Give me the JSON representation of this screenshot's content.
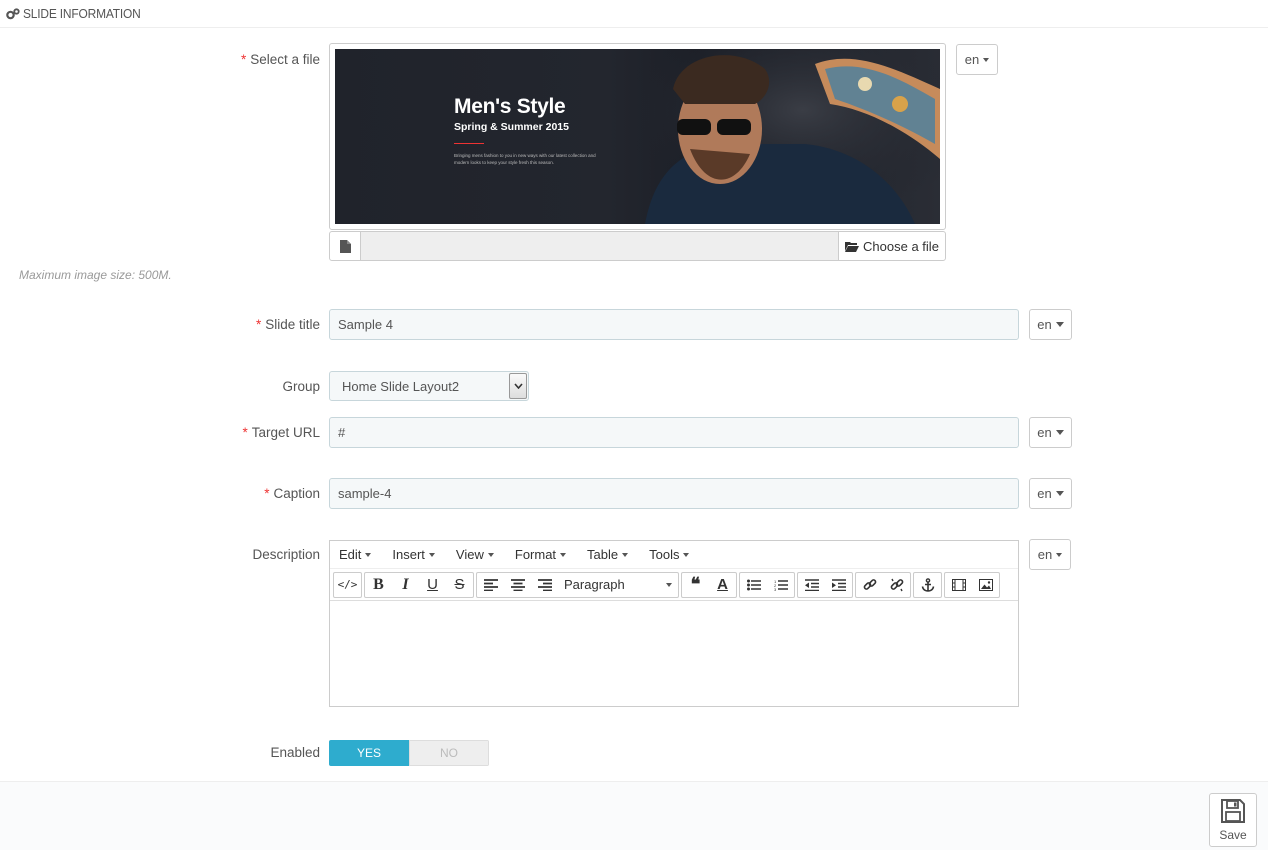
{
  "panel": {
    "title": "SLIDE INFORMATION"
  },
  "labels": {
    "file": "Select a file",
    "slide_title": "Slide title",
    "group": "Group",
    "target_url": "Target URL",
    "caption": "Caption",
    "description": "Description",
    "enabled": "Enabled",
    "required_mark": "*"
  },
  "lang": "en",
  "banner": {
    "title": "Men's Style",
    "subtitle": "Spring & Summer 2015",
    "body": "Bringing mens fashion to you in new ways with our latest collection and modern looks to keep your style fresh this season."
  },
  "file": {
    "choose_label": "Choose a file",
    "hint": "Maximum image size: 500M."
  },
  "fields": {
    "slide_title": "Sample 4",
    "target_url": "#",
    "caption": "sample-4",
    "group": "Home Slide Layout2"
  },
  "editor": {
    "menus": [
      "Edit",
      "Insert",
      "View",
      "Format",
      "Table",
      "Tools"
    ],
    "block_format": "Paragraph"
  },
  "toggle": {
    "yes": "YES",
    "no": "NO",
    "value": true
  },
  "save_label": "Save",
  "colors": {
    "accent": "#2eacce",
    "required": "#e33333"
  }
}
